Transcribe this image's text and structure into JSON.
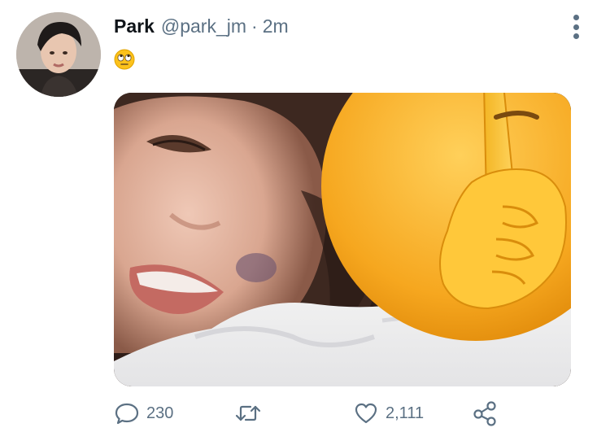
{
  "tweet": {
    "display_name": "Park",
    "handle": "@park_jm",
    "separator": "·",
    "time": "2m",
    "text_emoji": "eye-roll-emoji"
  },
  "actions": {
    "reply_count": "230",
    "retweet_count": "",
    "like_count": "2,111"
  },
  "icons": {
    "reply": "speech-bubble-icon",
    "retweet": "retweet-arrows-icon",
    "like": "heart-outline-icon",
    "share": "share-nodes-icon",
    "more": "vertical-dots-icon"
  },
  "colors": {
    "secondary_text": "#5b7083",
    "primary_text": "#0f1419"
  }
}
